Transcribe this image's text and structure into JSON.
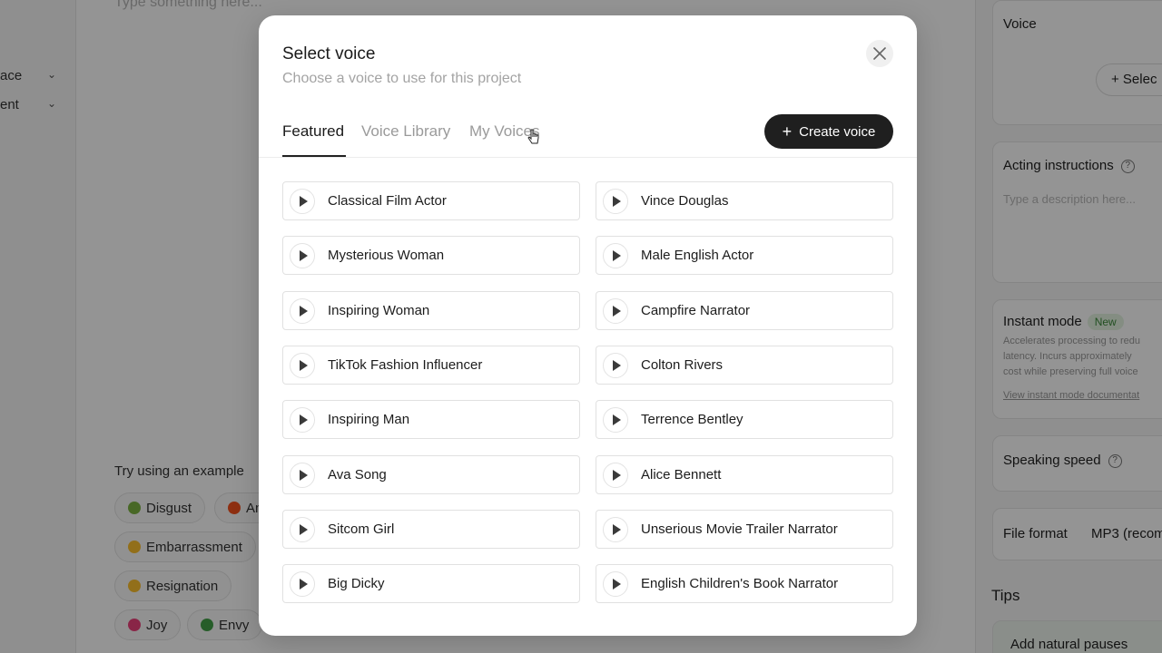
{
  "background": {
    "left_nav": [
      {
        "label": "ace"
      },
      {
        "label": "ent"
      }
    ],
    "text_placeholder": "Type something here...",
    "examples": {
      "title": "Try using an example",
      "chips": [
        {
          "label": "Disgust",
          "color": "#7cb342"
        },
        {
          "label": "An",
          "color": "#f4511e"
        },
        {
          "label": "Embarrassment",
          "color": "#fbc02d"
        },
        {
          "label": "Resignation",
          "color": "#fbc02d"
        },
        {
          "label": "Joy",
          "color": "#ec407a"
        },
        {
          "label": "Envy",
          "color": "#43a047"
        }
      ]
    },
    "right_panel": {
      "voice_label": "Voice",
      "select_button": "+ Selec",
      "acting_label": "Acting instructions",
      "acting_placeholder": "Type a description here...",
      "instant_label": "Instant mode",
      "instant_badge": "New",
      "instant_desc_1": "Accelerates processing to redu",
      "instant_desc_2": "latency. Incurs approximately",
      "instant_desc_3": "cost while preserving full voice",
      "instant_link": "View instant mode documentat",
      "speed_label": "Speaking speed",
      "format_label": "File format",
      "format_value": "MP3 (recom",
      "tips_label": "Tips",
      "tip_item": "Add natural pauses"
    }
  },
  "modal": {
    "title": "Select voice",
    "subtitle": "Choose a voice to use for this project",
    "tabs": [
      {
        "label": "Featured",
        "active": true
      },
      {
        "label": "Voice Library",
        "active": false
      },
      {
        "label": "My Voices",
        "active": false
      }
    ],
    "create_button": "Create voice",
    "voices_left": [
      "Classical Film Actor",
      "Mysterious Woman",
      "Inspiring Woman",
      "TikTok Fashion Influencer",
      "Inspiring Man",
      "Ava Song",
      "Sitcom Girl",
      "Big Dicky"
    ],
    "voices_right": [
      "Vince Douglas",
      "Male English Actor",
      "Campfire Narrator",
      "Colton Rivers",
      "Terrence Bentley",
      "Alice Bennett",
      "Unserious Movie Trailer Narrator",
      "English Children's Book Narrator"
    ]
  }
}
